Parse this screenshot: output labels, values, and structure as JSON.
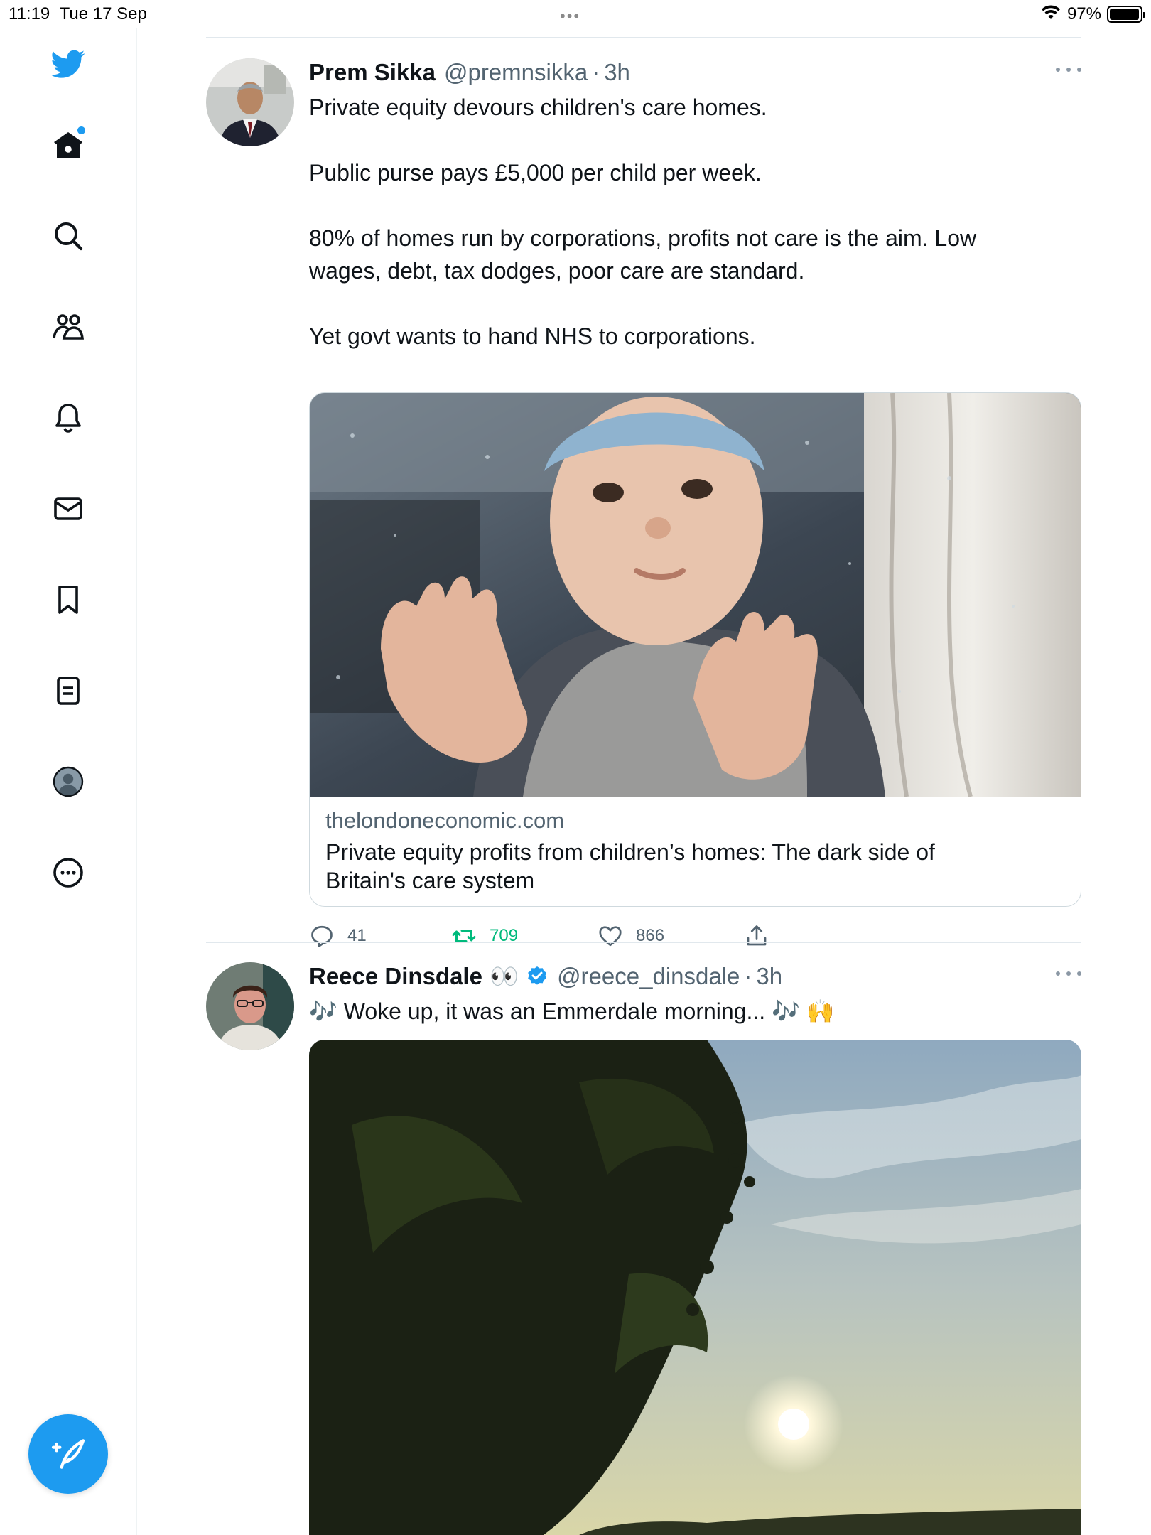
{
  "status_bar": {
    "time": "11:19",
    "date": "Tue 17 Sep",
    "center": "•••",
    "battery_text": "97%",
    "battery_level": 0.97
  },
  "sidebar": {
    "items": [
      {
        "icon": "twitter-logo-icon"
      },
      {
        "icon": "home-icon",
        "has_notification_dot": true
      },
      {
        "icon": "search-icon"
      },
      {
        "icon": "communities-icon"
      },
      {
        "icon": "notifications-bell-icon"
      },
      {
        "icon": "messages-envelope-icon"
      },
      {
        "icon": "bookmark-icon"
      },
      {
        "icon": "lists-icon"
      },
      {
        "icon": "profile-avatar-icon"
      },
      {
        "icon": "more-circle-icon"
      }
    ],
    "compose_icon": "compose-feather-icon",
    "accent_color": "#1d9bf0"
  },
  "tweets": [
    {
      "author_name": "Prem Sikka",
      "handle": "@premnsikka",
      "separator": "·",
      "time": "3h",
      "text_lines": [
        "Private equity devours children's care homes.",
        "",
        "Public purse pays £5,000 per child per week.",
        "",
        "80% of homes run by corporations, profits not care is the aim. Low",
        "wages, debt, tax dodges, poor care are standard.",
        "",
        "Yet govt wants to hand NHS to corporations."
      ],
      "card": {
        "domain": "thelondoneconomic.com",
        "title_line1": "Private equity profits from children’s homes: The dark side of",
        "title_line2": "Britain's care system"
      },
      "actions": {
        "replies": "41",
        "retweets": "709",
        "likes": "866"
      }
    },
    {
      "author_name": "Reece Dinsdale",
      "name_emoji": "👀",
      "verified": true,
      "handle": "@reece_dinsdale",
      "separator": "·",
      "time": "3h",
      "text": "🎶 Woke up, it was an Emmerdale morning... 🎶 🙌"
    }
  ],
  "colors": {
    "text_primary": "#0f1419",
    "text_secondary": "#536471",
    "retweet_green": "#00ba7c",
    "brand_blue": "#1d9bf0"
  }
}
